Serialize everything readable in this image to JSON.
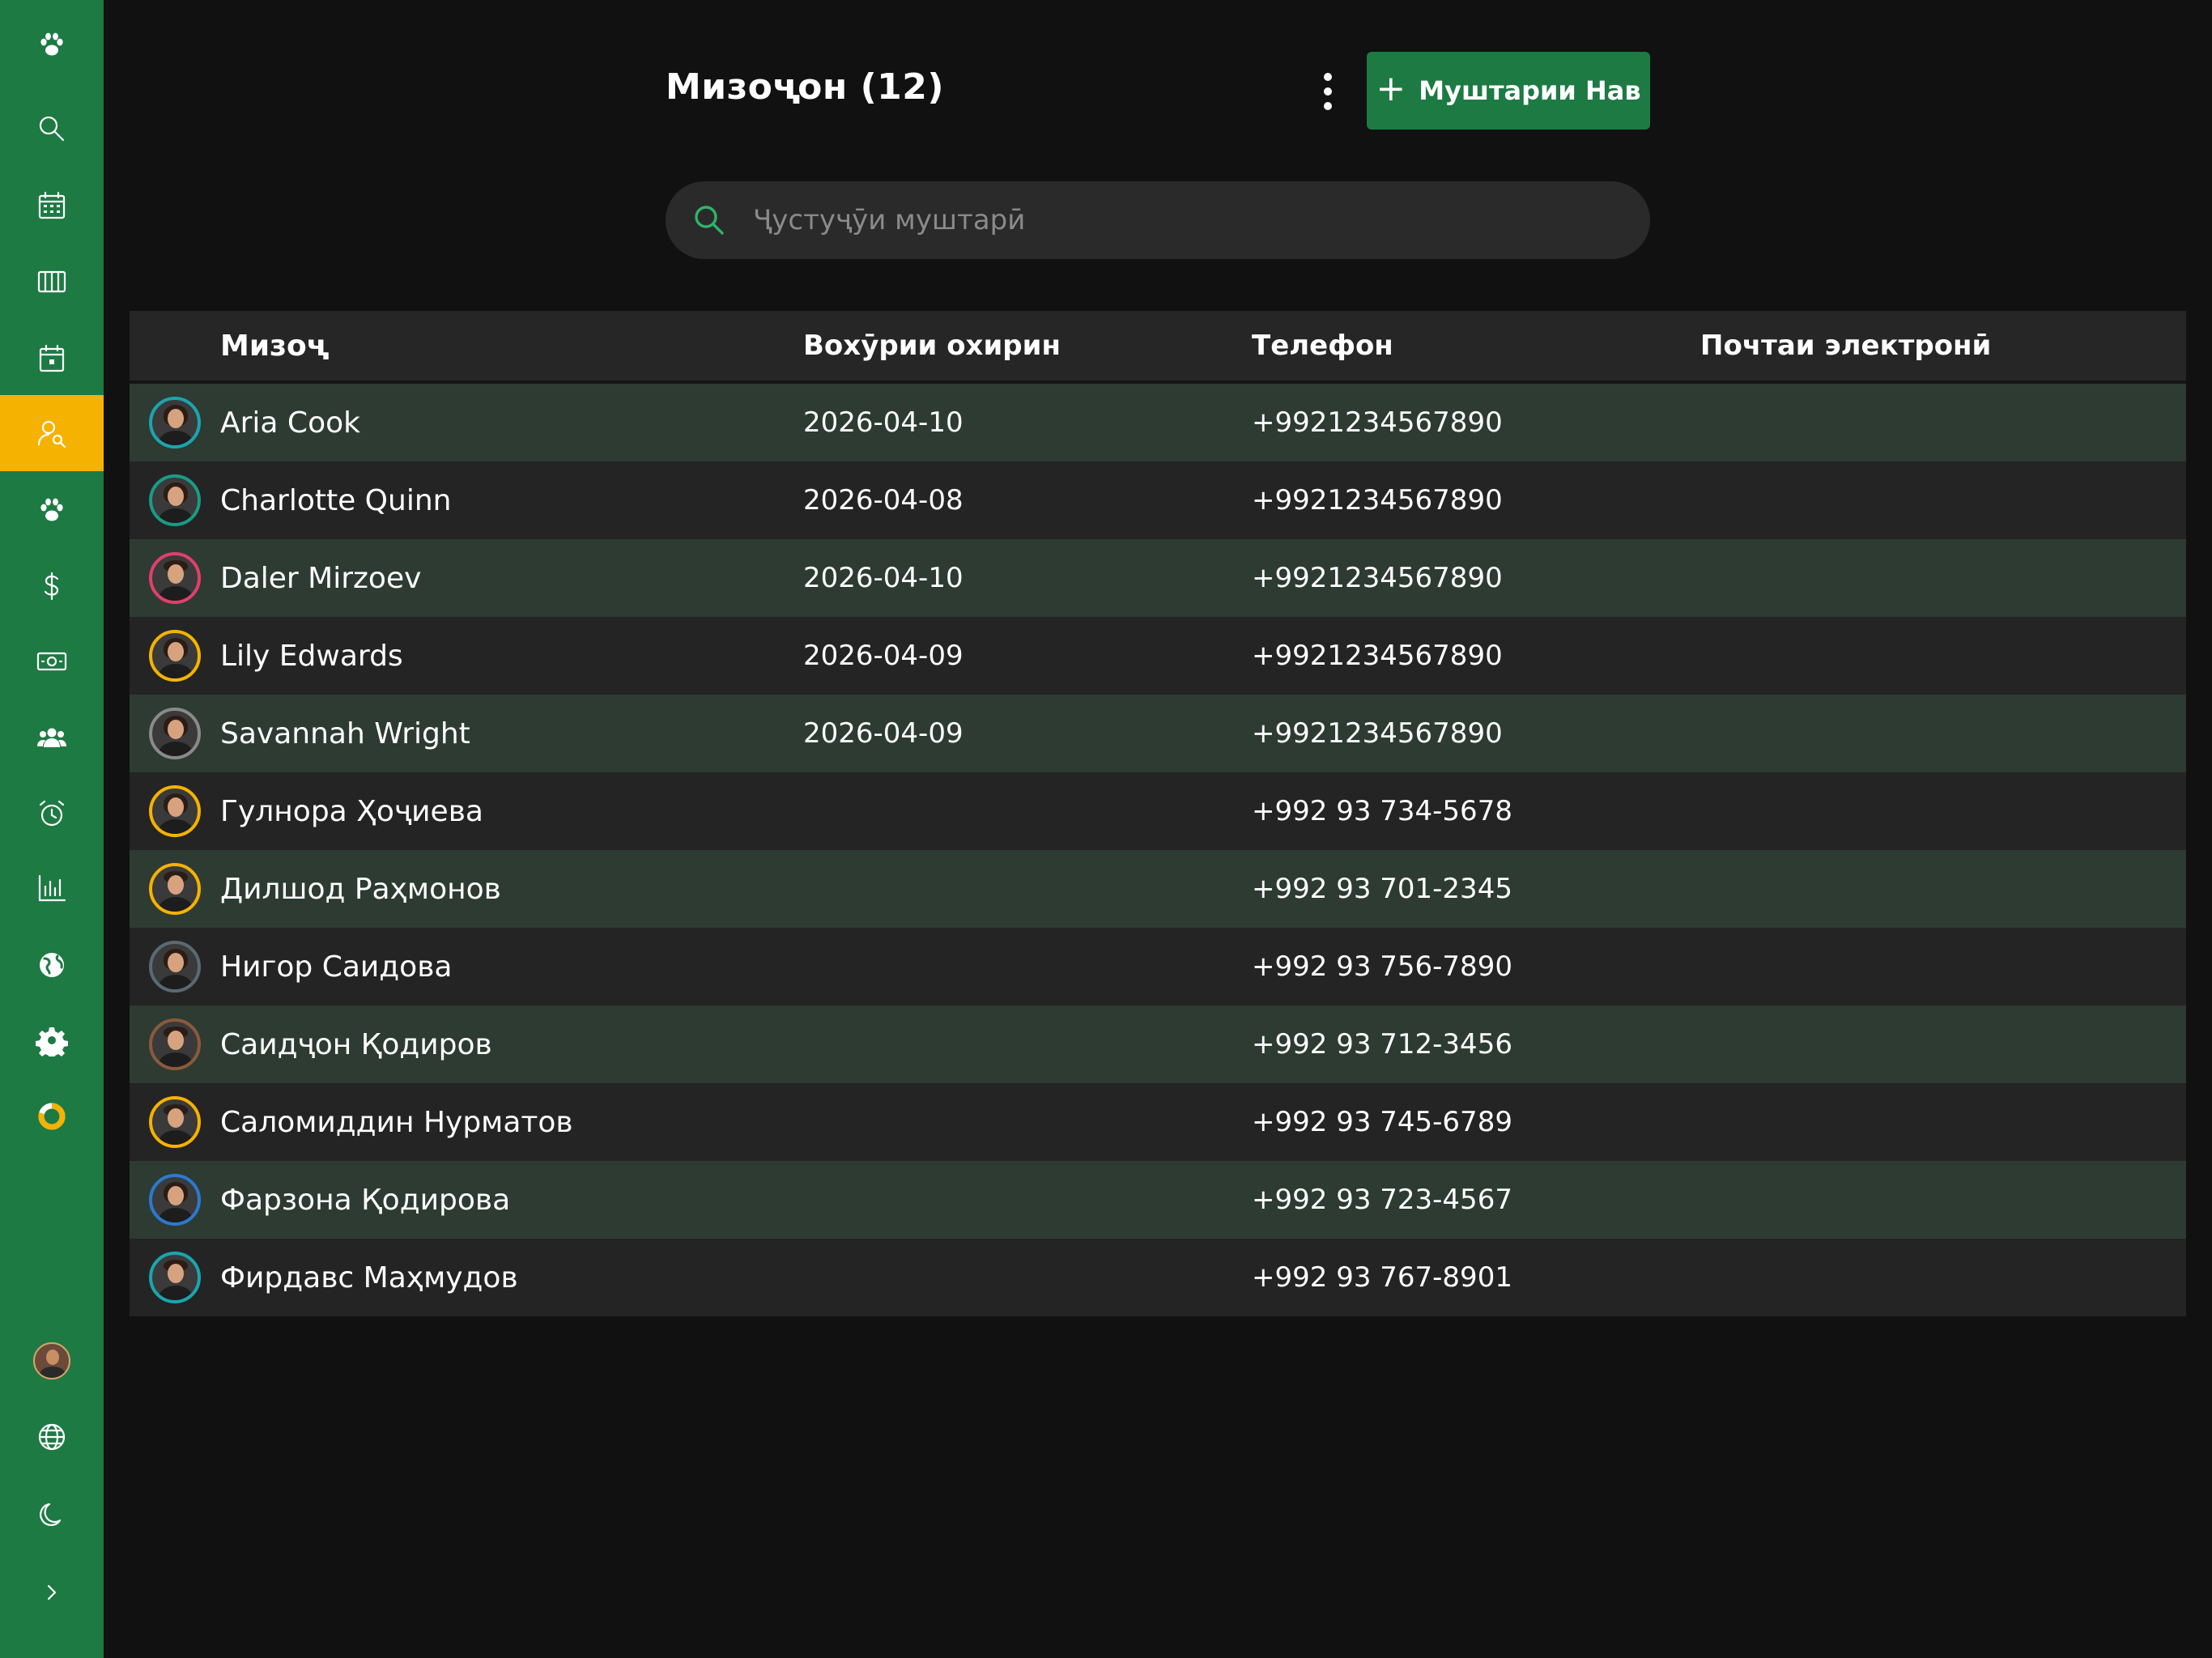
{
  "sidebar": {
    "items": [
      {
        "icon": "paw-icon",
        "id": "logo"
      },
      {
        "icon": "search-icon",
        "id": "search"
      },
      {
        "icon": "calendar-icon",
        "id": "calendar"
      },
      {
        "icon": "columns-icon",
        "id": "board"
      },
      {
        "icon": "calendar-day-icon",
        "id": "appointments"
      },
      {
        "icon": "user-search-icon",
        "id": "clients",
        "active": true
      },
      {
        "icon": "paw-icon",
        "id": "pets"
      },
      {
        "icon": "dollar-icon",
        "id": "payments"
      },
      {
        "icon": "cash-icon",
        "id": "cash"
      },
      {
        "icon": "users-icon",
        "id": "staff"
      },
      {
        "icon": "alarm-icon",
        "id": "reminders"
      },
      {
        "icon": "bar-chart-icon",
        "id": "reports"
      },
      {
        "icon": "globe-icon",
        "id": "web"
      },
      {
        "icon": "gear-icon",
        "id": "settings"
      },
      {
        "icon": "donut-icon",
        "id": "usage"
      }
    ],
    "bottom": [
      {
        "icon": "avatar",
        "id": "profile"
      },
      {
        "icon": "globe-outline-icon",
        "id": "language"
      },
      {
        "icon": "moon-icon",
        "id": "theme"
      },
      {
        "icon": "chevron-right-icon",
        "id": "expand"
      }
    ],
    "accent": "#1d7a43",
    "active_color": "#f5b200"
  },
  "header": {
    "title": "Мизоҷон (12)",
    "new_button_label": "Муштарии Нав"
  },
  "search": {
    "placeholder": "Ҷустуҷӯи муштарӣ",
    "value": ""
  },
  "table": {
    "columns": [
      "Мизоҷ",
      "Вохӯрии охирин",
      "Телефон",
      "Почтаи электронӣ"
    ],
    "rows": [
      {
        "name": "Aria Cook",
        "last_visit": "2026-04-10",
        "phone": "+9921234567890",
        "email": "",
        "ring": "#1aa5b0",
        "gender": "f"
      },
      {
        "name": "Charlotte Quinn",
        "last_visit": "2026-04-08",
        "phone": "+9921234567890",
        "email": "",
        "ring": "#1a9b86",
        "gender": "f"
      },
      {
        "name": "Daler Mirzoev",
        "last_visit": "2026-04-10",
        "phone": "+9921234567890",
        "email": "",
        "ring": "#e0406a",
        "gender": "m"
      },
      {
        "name": "Lily Edwards",
        "last_visit": "2026-04-09",
        "phone": "+9921234567890",
        "email": "",
        "ring": "#f5b200",
        "gender": "f"
      },
      {
        "name": "Savannah Wright",
        "last_visit": "2026-04-09",
        "phone": "+9921234567890",
        "email": "",
        "ring": "#8a8a8a",
        "gender": "f"
      },
      {
        "name": "Гулнора Ҳоҷиева",
        "last_visit": "",
        "phone": "+992 93 734-5678",
        "email": "",
        "ring": "#f5b200",
        "gender": "f"
      },
      {
        "name": "Дилшод Раҳмонов",
        "last_visit": "",
        "phone": "+992 93 701-2345",
        "email": "",
        "ring": "#f5b200",
        "gender": "m"
      },
      {
        "name": "Нигор Саидова",
        "last_visit": "",
        "phone": "+992 93 756-7890",
        "email": "",
        "ring": "#5a6a74",
        "gender": "f"
      },
      {
        "name": "Саидҷон Қодиров",
        "last_visit": "",
        "phone": "+992 93 712-3456",
        "email": "",
        "ring": "#8a5a3a",
        "gender": "m"
      },
      {
        "name": "Саломиддин Нурматов",
        "last_visit": "",
        "phone": "+992 93 745-6789",
        "email": "",
        "ring": "#f5b200",
        "gender": "m"
      },
      {
        "name": "Фарзона Қодирова",
        "last_visit": "",
        "phone": "+992 93 723-4567",
        "email": "",
        "ring": "#2a7ad0",
        "gender": "f"
      },
      {
        "name": "Фирдавс Маҳмудов",
        "last_visit": "",
        "phone": "+992 93 767-8901",
        "email": "",
        "ring": "#1aa5b0",
        "gender": "m"
      }
    ]
  }
}
